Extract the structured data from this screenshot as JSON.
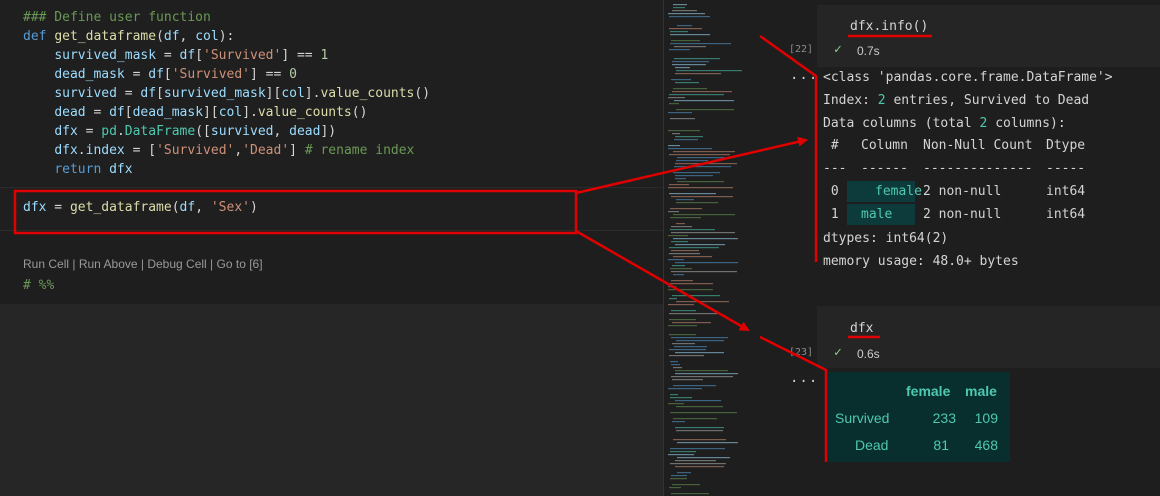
{
  "editor": {
    "cell1_lines": [
      "### Define user function",
      "def get_dataframe(df, col):",
      "    survived_mask = df['Survived'] == 1",
      "    dead_mask = df['Survived'] == 0",
      "    survived = df[survived_mask][col].value_counts()",
      "    dead = df[dead_mask][col].value_counts()",
      "    dfx = pd.DataFrame([survived, dead])",
      "    dfx.index = ['Survived','Dead'] # rename index",
      "    return dfx"
    ],
    "cell2_line": "dfx = get_dataframe(df, 'Sex')",
    "codelens": {
      "run_cell": "Run Cell",
      "run_above": "Run Above",
      "debug_cell": "Debug Cell",
      "goto": "Go to [6]",
      "sep": " | "
    },
    "cell3_line": "# %%"
  },
  "output": {
    "cell22": {
      "code": "dfx.info()",
      "exec_count": "[22]",
      "time": "0.7s",
      "more": "...",
      "lines": [
        "<class 'pandas.core.frame.DataFrame'>",
        "Index: 2 entries, Survived to Dead",
        "Data columns (total 2 columns):"
      ],
      "table_header": [
        " #",
        "Column",
        "Non-Null Count",
        "Dtype"
      ],
      "table_sep": [
        "---",
        "------",
        "--------------",
        "-----"
      ],
      "rows": [
        {
          "idx": " 0",
          "col": "female",
          "nn": "2 non-null",
          "dtype": "int64"
        },
        {
          "idx": " 1",
          "col": "male",
          "nn": "2 non-null",
          "dtype": "int64"
        }
      ],
      "dtypes": "dtypes: int64(2)",
      "memory": "memory usage: 48.0+ bytes"
    },
    "cell23": {
      "code": "dfx",
      "exec_count": "[23]",
      "time": "0.6s",
      "more": "...",
      "df_columns": [
        "female",
        "male"
      ],
      "df_rows": [
        {
          "label": "Survived",
          "female": "233",
          "male": "109"
        },
        {
          "label": "Dead",
          "female": "81",
          "male": "468"
        }
      ]
    }
  },
  "colors": {
    "annotation": "#e00000",
    "accent": "#4ec9b0",
    "check": "#89d185"
  }
}
